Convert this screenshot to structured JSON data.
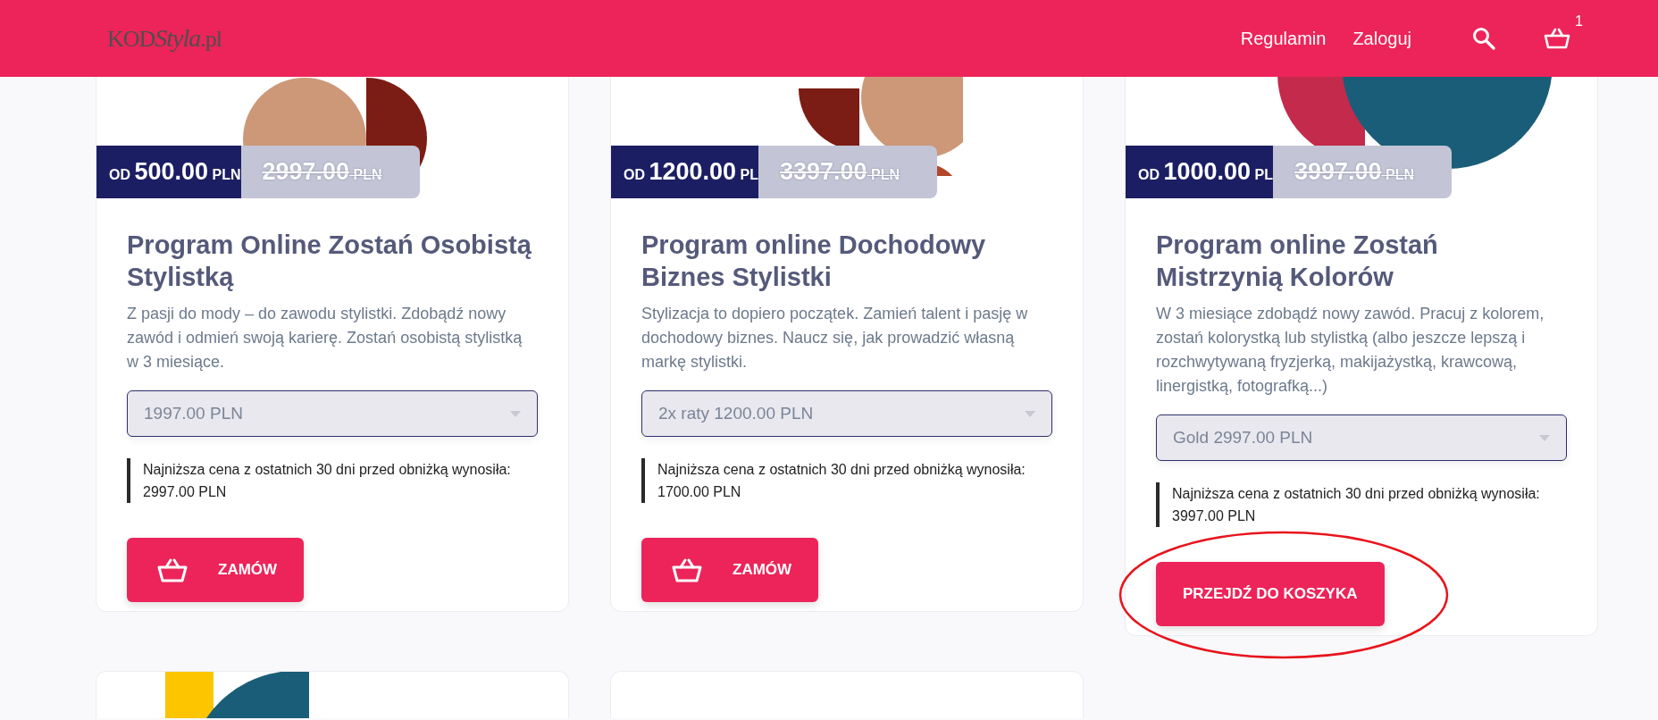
{
  "header": {
    "logo": [
      "KOD",
      "Styla",
      ".pl"
    ],
    "nav": [
      "Regulamin",
      "Zaloguj"
    ],
    "cart_count": "1"
  },
  "products": [
    {
      "kind": "product",
      "price": {
        "prefix": "OD",
        "amount": "500.00",
        "currency": "PLN"
      },
      "old_price": {
        "amount": "2997.00",
        "currency": "PLN"
      },
      "title": "Program Online Zostań Osobistą Stylistką",
      "description": "Z pasji do mody – do zawodu stylistki. Zdobądź nowy zawód i odmień swoją karierę. Zostań osobistą stylistką w 3 miesiące.",
      "variant": "1997.00 PLN",
      "lowest_price_note": "Najniższa cena z ostatnich 30 dni przed obniżką wynosiła: 2997.00 PLN",
      "button": {
        "kind": "order",
        "label": "ZAMÓW",
        "circled": false
      }
    },
    {
      "kind": "product",
      "price": {
        "prefix": "OD",
        "amount": "1200.00",
        "currency": "PL"
      },
      "old_price": {
        "amount": "3397.00",
        "currency": "PLN"
      },
      "title": "Program online Dochodowy Biznes Stylistki",
      "description": "Stylizacja to dopiero początek. Zamień talent i pasję w dochodowy biznes. Naucz się, jak prowadzić własną markę stylistki.",
      "variant": "2x raty 1200.00 PLN",
      "lowest_price_note": "Najniższa cena z ostatnich 30 dni przed obniżką wynosiła: 1700.00 PLN",
      "button": {
        "kind": "order",
        "label": "ZAMÓW",
        "circled": false
      }
    },
    {
      "kind": "product",
      "price": {
        "prefix": "OD",
        "amount": "1000.00",
        "currency": "PL"
      },
      "old_price": {
        "amount": "3997.00",
        "currency": "PLN"
      },
      "title": "Program online Zostań Mistrzynią Kolorów",
      "description": " W 3 miesiące zdobądź nowy zawód. Pracuj z kolorem, zostań kolorystką lub stylistką (albo jeszcze lepszą i rozchwytywaną fryzjerką, makijażystką, krawcową, linergistką, fotografką...)",
      "variant": "Gold 2997.00 PLN",
      "lowest_price_note": "Najniższa cena z ostatnich 30 dni przed obniżką wynosiła: 3997.00 PLN",
      "button": {
        "kind": "cart",
        "label": "PRZEJDŹ DO KOSZYKA",
        "circled": true
      }
    },
    {
      "kind": "picture"
    },
    {
      "kind": "blank"
    }
  ]
}
